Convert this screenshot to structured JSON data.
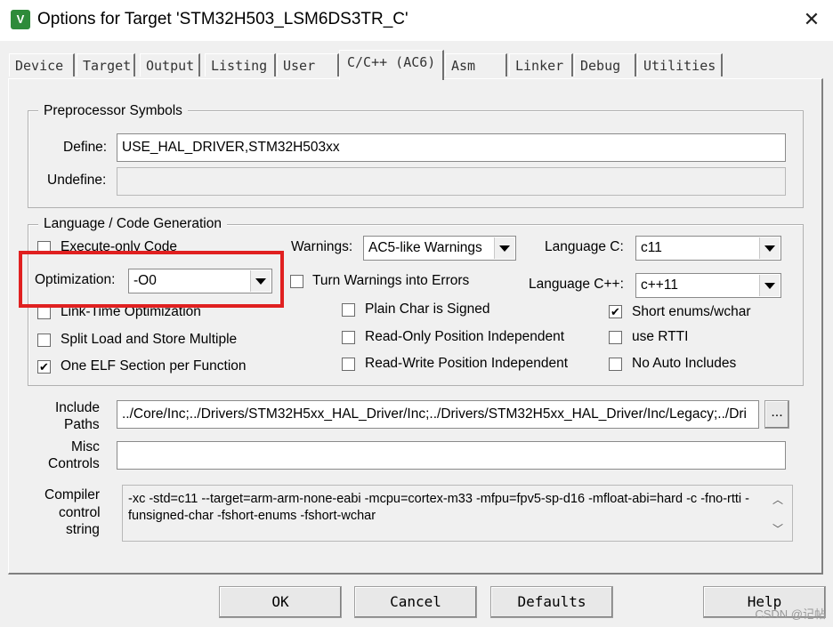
{
  "window": {
    "title": "Options for Target 'STM32H503_LSM6DS3TR_C'",
    "close_glyph": "✕",
    "icon_text": "V"
  },
  "tabs": [
    "Device",
    "Target",
    "Output",
    "Listing",
    "User",
    "C/C++ (AC6)",
    "Asm",
    "Linker",
    "Debug",
    "Utilities"
  ],
  "active_tab": "C/C++ (AC6)",
  "preprocessor": {
    "legend": "Preprocessor Symbols",
    "define_label": "Define:",
    "define_value": "USE_HAL_DRIVER,STM32H503xx",
    "undefine_label": "Undefine:",
    "undefine_value": ""
  },
  "language": {
    "legend": "Language / Code Generation",
    "execute_only": {
      "label": "Execute-only Code",
      "checked": false
    },
    "optimization_label": "Optimization:",
    "optimization_value": "-O0",
    "link_time": {
      "label": "Link-Time Optimization",
      "checked": false
    },
    "split_load": {
      "label": "Split Load and Store Multiple",
      "checked": false
    },
    "one_elf": {
      "label": "One ELF Section per Function",
      "checked": true
    },
    "warnings_label": "Warnings:",
    "warnings_value": "AC5-like Warnings",
    "turn_warnings": {
      "label": "Turn Warnings into Errors",
      "checked": false
    },
    "plain_char": {
      "label": "Plain Char is Signed",
      "checked": false
    },
    "ro_pi": {
      "label": "Read-Only Position Independent",
      "checked": false
    },
    "rw_pi": {
      "label": "Read-Write Position Independent",
      "checked": false
    },
    "lang_c_label": "Language C:",
    "lang_c_value": "c11",
    "lang_cpp_label": "Language C++:",
    "lang_cpp_value": "c++11",
    "short_enums": {
      "label": "Short enums/wchar",
      "checked": true
    },
    "use_rtti": {
      "label": "use RTTI",
      "checked": false
    },
    "no_auto_includes": {
      "label": "No Auto Includes",
      "checked": false
    }
  },
  "include": {
    "label_1": "Include",
    "label_2": "Paths",
    "value": "../Core/Inc;../Drivers/STM32H5xx_HAL_Driver/Inc;../Drivers/STM32H5xx_HAL_Driver/Inc/Legacy;../Dri",
    "browse_label": "..."
  },
  "misc": {
    "label_1": "Misc",
    "label_2": "Controls",
    "value": ""
  },
  "compiler": {
    "label_1": "Compiler",
    "label_2": "control",
    "label_3": "string",
    "value": "-xc -std=c11 --target=arm-arm-none-eabi -mcpu=cortex-m33 -mfpu=fpv5-sp-d16 -mfloat-abi=hard -c -fno-rtti -funsigned-char -fshort-enums -fshort-wchar"
  },
  "buttons": {
    "ok": "OK",
    "cancel": "Cancel",
    "defaults": "Defaults",
    "help": "Help"
  },
  "watermark": "CSDN @记帖",
  "check_glyph": "✔",
  "highlight_color": "#e02020"
}
